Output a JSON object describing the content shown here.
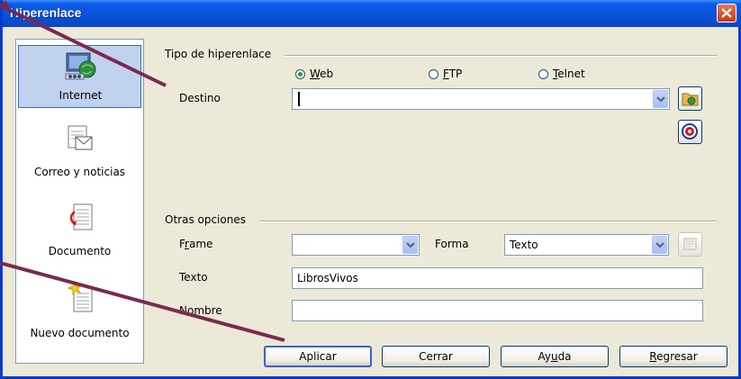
{
  "window": {
    "title": "Hiperenlace"
  },
  "sidebar": {
    "items": [
      {
        "label": "Internet",
        "icon": "internet-globe-icon",
        "active": true
      },
      {
        "label": "Correo y noticias",
        "icon": "mail-news-icon",
        "active": false
      },
      {
        "label": "Documento",
        "icon": "document-icon",
        "active": false
      },
      {
        "label": "Nuevo documento",
        "icon": "new-document-icon",
        "active": false
      }
    ]
  },
  "hyperlink_type": {
    "group_title": "Tipo de hiperenlace",
    "options": [
      {
        "pre": "",
        "key": "W",
        "post": "eb",
        "selected": true
      },
      {
        "pre": "",
        "key": "F",
        "post": "TP",
        "selected": false
      },
      {
        "pre": "",
        "key": "T",
        "post": "elnet",
        "selected": false
      }
    ],
    "destino_label": "Destino",
    "destino_value": ""
  },
  "other_options": {
    "group_title": "Otras opciones",
    "frame_label_pre": "F",
    "frame_label_key": "r",
    "frame_label_post": "ame",
    "frame_value": "",
    "forma_label": "Forma",
    "forma_value": "Texto",
    "texto_label": "Texto",
    "texto_value": "LibrosVivos",
    "nombre_label": "Nombre",
    "nombre_value": ""
  },
  "buttons": {
    "apply": "Aplicar",
    "close": "Cerrar",
    "help_pre": "Ay",
    "help_key": "u",
    "help_post": "da",
    "back_pre": "",
    "back_key": "R",
    "back_post": "egresar"
  },
  "colors": {
    "titlebar": "#0852d6",
    "selection": "#c1d2ee",
    "radio_dot": "#21a121",
    "annotation_arrow": "#7a2a4f"
  }
}
